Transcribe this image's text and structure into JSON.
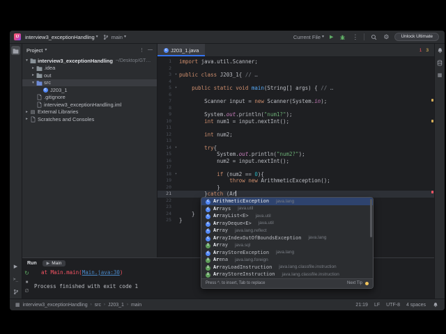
{
  "titlebar": {
    "project_name": "interview3_exceptionHandling",
    "branch_name": "main",
    "run_config": "Current File",
    "unlock_label": "Unlock Ultimate"
  },
  "left_strip": {
    "top": [
      "project-folder"
    ],
    "bottom": [
      "run",
      "terminal",
      "version-control"
    ]
  },
  "right_strip": {
    "top": [
      "notifications",
      "database",
      "gradle"
    ]
  },
  "project_panel": {
    "title": "Project",
    "tree": [
      {
        "label": "interview3_exceptionHandling",
        "hint": "~/Desktop/GTC school/JAVA (I)",
        "indent": 0,
        "icon": "folder",
        "chevron": "open",
        "selected": false
      },
      {
        "label": ".idea",
        "indent": 1,
        "icon": "folder",
        "chevron": "closed",
        "selected": false
      },
      {
        "label": "out",
        "indent": 1,
        "icon": "folder",
        "chevron": "closed",
        "selected": false
      },
      {
        "label": "src",
        "indent": 1,
        "icon": "folder-src",
        "chevron": "open",
        "selected": true
      },
      {
        "label": "J203_1",
        "indent": 2,
        "icon": "class",
        "chevron": "none",
        "selected": false
      },
      {
        "label": ".gitignore",
        "indent": 1,
        "icon": "file",
        "chevron": "none",
        "selected": false
      },
      {
        "label": "interview3_exceptionHandling.iml",
        "indent": 1,
        "icon": "file",
        "chevron": "none",
        "selected": false
      },
      {
        "label": "External Libraries",
        "indent": 0,
        "icon": "library",
        "chevron": "closed",
        "selected": false
      },
      {
        "label": "Scratches and Consoles",
        "indent": 0,
        "icon": "scratch",
        "chevron": "closed",
        "selected": false
      }
    ]
  },
  "editor": {
    "tab_label": "J203_1.java",
    "problems": {
      "errors": "1",
      "warnings": "3"
    },
    "typed_prefix": "Ar",
    "lines": [
      {
        "n": 1,
        "seg": [
          [
            "k",
            "import"
          ],
          [
            "p",
            " java.util.Scanner;"
          ]
        ]
      },
      {
        "n": 2,
        "seg": []
      },
      {
        "n": 3,
        "fold": true,
        "seg": [
          [
            "k",
            "public class"
          ],
          [
            "p",
            " J203_1{ "
          ],
          [
            "c",
            "// …"
          ]
        ]
      },
      {
        "n": 4,
        "seg": []
      },
      {
        "n": 5,
        "fold": true,
        "seg": [
          [
            "p",
            "    "
          ],
          [
            "k",
            "public static void"
          ],
          [
            "p",
            " "
          ],
          [
            "m",
            "main"
          ],
          [
            "p",
            "(String[] args) { "
          ],
          [
            "c",
            "// …"
          ]
        ]
      },
      {
        "n": 6,
        "seg": []
      },
      {
        "n": 7,
        "seg": [
          [
            "p",
            "        Scanner input = "
          ],
          [
            "k",
            "new"
          ],
          [
            "p",
            " Scanner(System."
          ],
          [
            "f",
            "in"
          ],
          [
            "p",
            ");"
          ]
        ]
      },
      {
        "n": 8,
        "seg": []
      },
      {
        "n": 9,
        "seg": [
          [
            "p",
            "        System."
          ],
          [
            "f",
            "out"
          ],
          [
            "p",
            ".println("
          ],
          [
            "s",
            "\"num1?\""
          ],
          [
            "p",
            ");"
          ]
        ]
      },
      {
        "n": 10,
        "seg": [
          [
            "p",
            "        "
          ],
          [
            "k",
            "int"
          ],
          [
            "p",
            " num1 = input.nextInt();"
          ]
        ]
      },
      {
        "n": 11,
        "seg": []
      },
      {
        "n": 12,
        "seg": [
          [
            "p",
            "        "
          ],
          [
            "k",
            "int"
          ],
          [
            "p",
            " num2;"
          ]
        ]
      },
      {
        "n": 13,
        "seg": []
      },
      {
        "n": 14,
        "fold": true,
        "seg": [
          [
            "p",
            "        "
          ],
          [
            "k",
            "try"
          ],
          [
            "p",
            "{"
          ]
        ]
      },
      {
        "n": 15,
        "seg": [
          [
            "p",
            "            System."
          ],
          [
            "f",
            "out"
          ],
          [
            "p",
            ".println("
          ],
          [
            "s",
            "\"num2?\""
          ],
          [
            "p",
            ");"
          ]
        ]
      },
      {
        "n": 16,
        "seg": [
          [
            "p",
            "            num2 = input.nextInt();"
          ]
        ]
      },
      {
        "n": 17,
        "seg": []
      },
      {
        "n": 18,
        "fold": true,
        "seg": [
          [
            "p",
            "            "
          ],
          [
            "k",
            "if"
          ],
          [
            "p",
            " (num2 == "
          ],
          [
            "n",
            "0"
          ],
          [
            "p",
            "){"
          ]
        ]
      },
      {
        "n": 19,
        "seg": [
          [
            "p",
            "                "
          ],
          [
            "k",
            "throw"
          ],
          [
            "p",
            " "
          ],
          [
            "k",
            "new"
          ],
          [
            "p",
            " ArithmeticException();"
          ]
        ]
      },
      {
        "n": 20,
        "seg": [
          [
            "p",
            "            }"
          ]
        ]
      },
      {
        "n": 21,
        "current": true,
        "caret": true,
        "seg": [
          [
            "p",
            "        }"
          ],
          [
            "k",
            "catch"
          ],
          [
            "p",
            " (Ar"
          ]
        ]
      },
      {
        "n": 22,
        "seg": [
          [
            "p",
            "        }"
          ],
          [
            "k",
            "finally"
          ],
          [
            "p",
            "{"
          ]
        ]
      },
      {
        "n": 23,
        "seg": []
      },
      {
        "n": 24,
        "seg": [
          [
            "p",
            "    }"
          ]
        ]
      },
      {
        "n": 25,
        "seg": [
          [
            "p",
            "}"
          ]
        ]
      }
    ]
  },
  "completion": {
    "items": [
      {
        "name": "ArithmeticException",
        "pkg": "java.lang",
        "kind": "class",
        "selected": true
      },
      {
        "name": "Arrays",
        "pkg": "java.util",
        "kind": "class",
        "selected": false
      },
      {
        "name": "ArrayList<E>",
        "pkg": "java.util",
        "kind": "class",
        "selected": false
      },
      {
        "name": "ArrayDeque<E>",
        "pkg": "java.util",
        "kind": "class",
        "selected": false
      },
      {
        "name": "Array",
        "pkg": "java.lang.reflect",
        "kind": "class",
        "selected": false
      },
      {
        "name": "ArrayIndexOutOfBoundsException",
        "pkg": "java.lang",
        "kind": "class",
        "selected": false
      },
      {
        "name": "Array",
        "pkg": "java.sql",
        "kind": "interface",
        "selected": false
      },
      {
        "name": "ArrayStoreException",
        "pkg": "java.lang",
        "kind": "class",
        "selected": false
      },
      {
        "name": "Arena",
        "pkg": "java.lang.foreign",
        "kind": "interface",
        "selected": false
      },
      {
        "name": "ArrayLoadInstruction",
        "pkg": "java.lang.classfile.instruction",
        "kind": "interface",
        "selected": false
      },
      {
        "name": "ArrayStoreInstruction",
        "pkg": "java.lang.classfile.instruction",
        "kind": "interface",
        "selected": false
      }
    ],
    "hint": "Press ^. to insert, Tab to replace",
    "next_tip": "Next Tip"
  },
  "run_panel": {
    "title": "Run",
    "tab_label": "Main",
    "toolbar": [
      "rerun",
      "stop",
      "clear"
    ],
    "console": [
      {
        "indent": 1,
        "segments": [
          {
            "t": "at Main.main(",
            "c": "error"
          },
          {
            "t": "Main.java:30",
            "c": "link"
          },
          {
            "t": ")",
            "c": "error"
          }
        ]
      },
      {
        "indent": 0,
        "segments": []
      },
      {
        "indent": 0,
        "segments": [
          {
            "t": "Process finished with exit code 1",
            "c": "plain"
          }
        ]
      }
    ]
  },
  "statusbar": {
    "breadcrumbs": [
      "interview3_exceptionHandling",
      "src",
      "J203_1",
      "main"
    ],
    "caret_position": "21:19",
    "line_separator": "LF",
    "encoding": "UTF-8",
    "indent_style": "4 spaces"
  }
}
